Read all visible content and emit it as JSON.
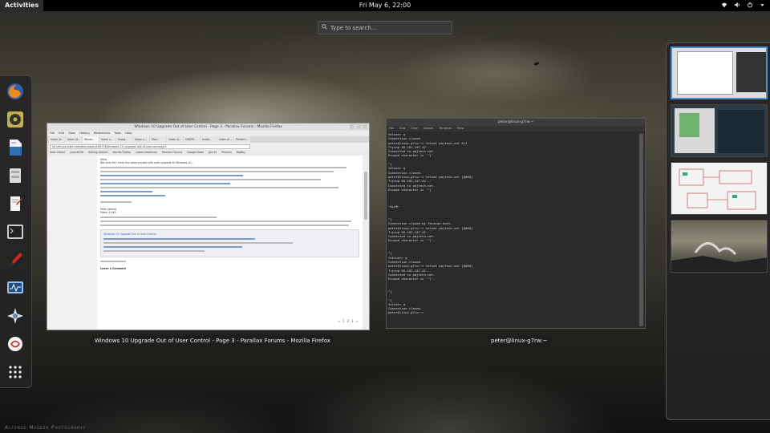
{
  "topbar": {
    "activities": "Activities",
    "clock": "Fri May  6, 22:00",
    "icons": [
      "wifi-icon",
      "volume-icon",
      "power-icon",
      "chevron-down-icon"
    ]
  },
  "search": {
    "placeholder": "Type to search…"
  },
  "dash": {
    "apps": [
      "firefox",
      "rhythmbox",
      "libreoffice-writer",
      "files",
      "text-editor",
      "terminal",
      "pinta",
      "system-monitor",
      "xchat",
      "evolution",
      "show-applications"
    ]
  },
  "windows": {
    "firefox": {
      "title": "Windows 10 Upgrade Out of User Control - Page 3 - Parallax Forums - Mozilla Firefox",
      "caption": "Windows 10 Upgrade Out of User Control - Page 3 - Parallax Forums - Mozilla Firefox",
      "menu": [
        "File",
        "Edit",
        "View",
        "History",
        "Bookmarks",
        "Tools",
        "Help"
      ],
      "url": "forums.parallax.com/discussion/164716/windows-10-upgrade-out-of-user-control/p3",
      "tabs": [
        "Inbox (4...",
        "Inbox (4...",
        "Windo...",
        "Inbox u...",
        "Googl...",
        "Inbox u...",
        "Mail...",
        "Inbox (4...",
        "GREPO...",
        "mode...",
        "Index of ...",
        "Perform..."
      ],
      "bookmarks": [
        "Most Visited",
        "pjsec6338",
        "Getting Started",
        "Mozilla Firefox",
        "Latest Headlines",
        "Parallax Forums",
        "Google News",
        "glxr19",
        "Phoenix",
        "BigBoy"
      ],
      "posts": {
        "author": "Peter Jakacki",
        "author_role": "Posts: 4,445",
        "intro": "Hello,",
        "body_line": "Not only did I have the same trouble with auto-upgrade to Windows 10...",
        "quote_title": "Windows 10 Upgrade Out of User Control",
        "leave_comment": "Leave a Comment"
      },
      "pager": [
        "«",
        "1",
        "2",
        "3",
        "»"
      ]
    },
    "terminal": {
      "title": "peter@linux-g7rw:~",
      "caption": "peter@linux-g7rw:~",
      "menu": [
        "File",
        "Edit",
        "View",
        "Search",
        "Terminal",
        "Help"
      ],
      "lines": [
        "telnet> q",
        "Connection closed.",
        "peter@linux-g7rw:~> telnet pbjtech.net 5LI",
        "Trying 50.181.247.42...",
        "Connected to pbjtech.net.",
        "Escape character is '^]'.",
        "",
        "^]",
        "telnet> q",
        "Connection closed.",
        "peter@linux-g7rw:~> telnet pbjtech.net [8080]",
        "Trying 50.181.247.42...",
        "Connected to pbjtech.net.",
        "Escape character is '^]'.",
        "",
        "",
        "",
        "~$+e¶~",
        "",
        "",
        "^]",
        "Connection closed by foreign host.",
        "peter@linux-g7rw:~> telnet pbjtech.net [8080]",
        "Trying 50.181.247.42...",
        "Connected to pbjtech.net.",
        "Escape character is '^]'.",
        "",
        "",
        "^]",
        "ttelnet> q",
        "Connection closed.",
        "peter@linux-g7rw:~> telnet pbjtech.net [8080]",
        "Trying 50.181.247.42...",
        "Connected to pbjtech.net.",
        "Escape character is '^]'.",
        "",
        "",
        "^]",
        "",
        "^]",
        "telnet> q",
        "Connection closed.",
        "peter@linux-g7rw:~> "
      ]
    }
  },
  "workspaces": [
    {
      "name": "workspace-1",
      "active": true
    },
    {
      "name": "workspace-2",
      "active": false
    },
    {
      "name": "workspace-3",
      "active": false
    },
    {
      "name": "workspace-4",
      "active": false
    }
  ],
  "wallpaper_credit": "Alfonso Maseda Photography",
  "colors": {
    "accent": "#4a90d9",
    "topbar": "#000000",
    "terminal_bg": "#2a2a2a"
  }
}
